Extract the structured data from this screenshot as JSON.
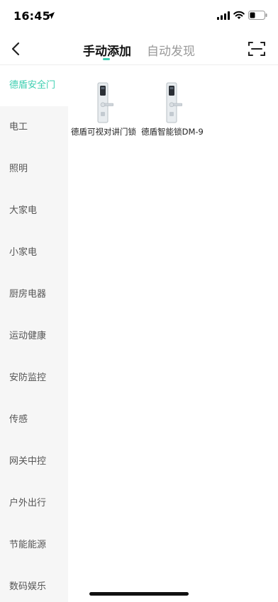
{
  "status_bar": {
    "time": "16:45"
  },
  "nav": {
    "tabs": [
      {
        "label": "手动添加",
        "active": true
      },
      {
        "label": "自动发现",
        "active": false
      }
    ]
  },
  "sidebar": {
    "items": [
      {
        "label": "德盾安全门",
        "active": true
      },
      {
        "label": "电工"
      },
      {
        "label": "照明"
      },
      {
        "label": "大家电"
      },
      {
        "label": "小家电"
      },
      {
        "label": "厨房电器"
      },
      {
        "label": "运动健康"
      },
      {
        "label": "安防监控"
      },
      {
        "label": "传感"
      },
      {
        "label": "网关中控"
      },
      {
        "label": "户外出行"
      },
      {
        "label": "节能能源"
      },
      {
        "label": "数码娱乐"
      }
    ]
  },
  "products": [
    {
      "name": "德盾可视对讲门锁",
      "icon": "door-lock-icon"
    },
    {
      "name": "德盾智能锁DM-9",
      "icon": "door-lock-icon"
    }
  ],
  "colors": {
    "accent": "#3ecfb1",
    "sidebar_bg": "#f6f6f6"
  }
}
